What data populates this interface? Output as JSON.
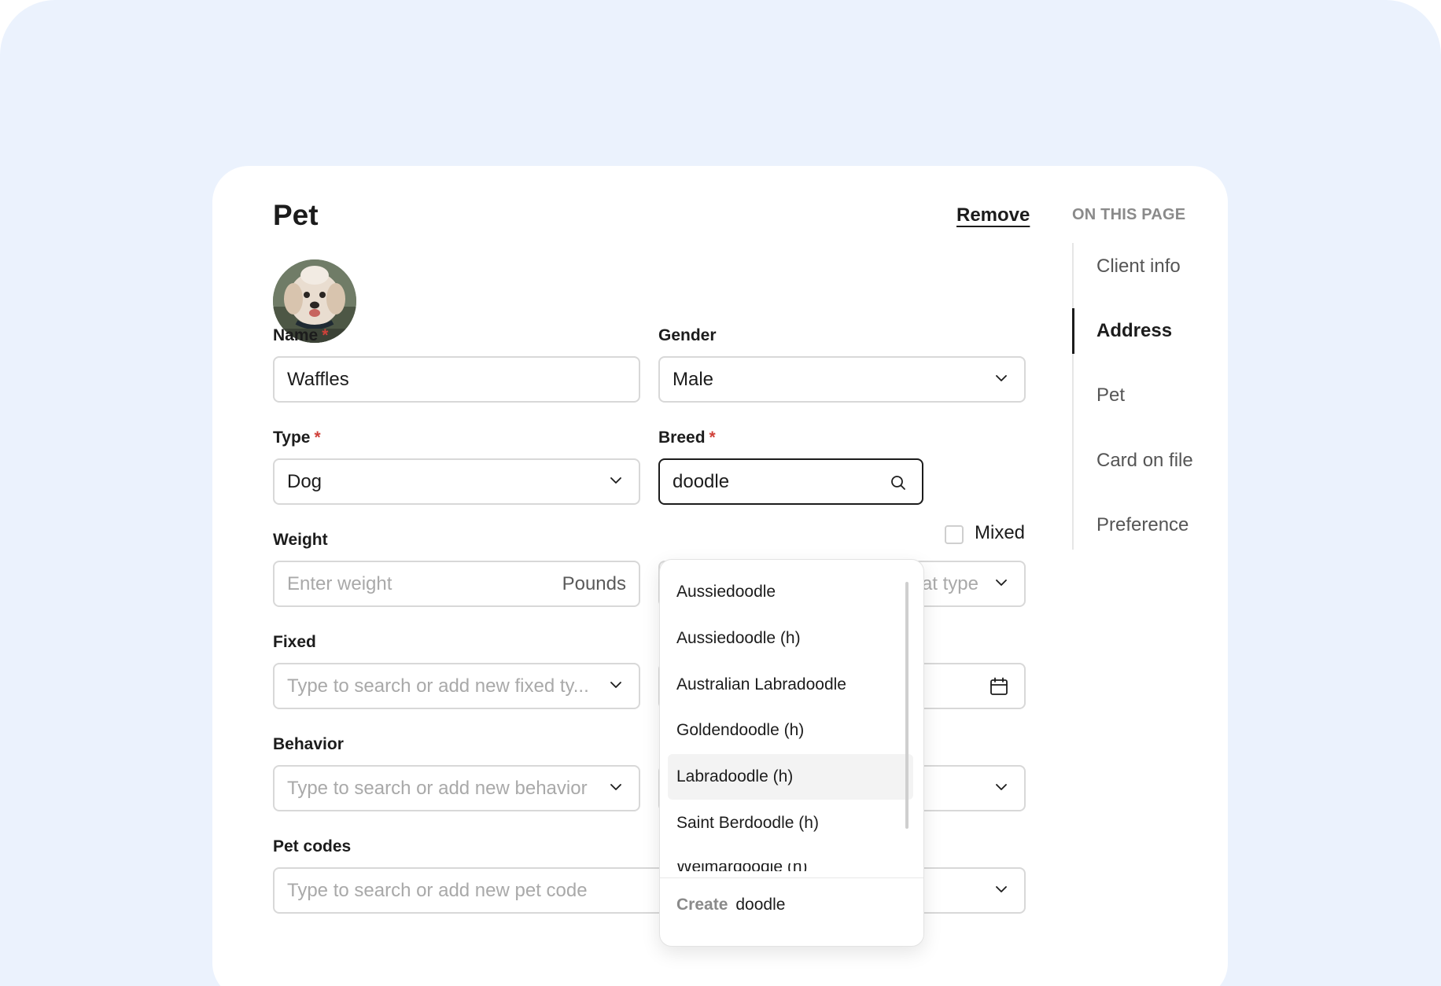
{
  "page": {
    "title": "Pet",
    "remove_label": "Remove"
  },
  "avatar": {
    "alt": "Pet photo"
  },
  "form": {
    "name": {
      "label": "Name",
      "required": "*",
      "value": "Waffles"
    },
    "gender": {
      "label": "Gender",
      "value": "Male"
    },
    "type": {
      "label": "Type",
      "required": "*",
      "value": "Dog"
    },
    "breed": {
      "label": "Breed",
      "required": "*",
      "value": "doodle",
      "mixed_label": "Mixed"
    },
    "weight": {
      "label": "Weight",
      "placeholder": "Enter weight",
      "unit": "Pounds",
      "coat_placeholder_partial": "at type"
    },
    "fixed": {
      "label": "Fixed",
      "placeholder": "Type to search or add new fixed ty..."
    },
    "behavior": {
      "label": "Behavior",
      "placeholder": "Type to search or add new behavior"
    },
    "pet_codes": {
      "label": "Pet codes",
      "placeholder": "Type to search or add new pet code"
    }
  },
  "breed_dropdown": {
    "options": [
      "Aussiedoodle",
      "Aussiedoodle (h)",
      "Australian Labradoodle",
      "Goldendoodle (h)",
      "Labradoodle (h)",
      "Saint Berdoodle (h)"
    ],
    "highlighted": "Labradoodle (h)",
    "partial_option": "Weimardoodle (h)",
    "create_label": "Create",
    "create_value": "doodle"
  },
  "toc": {
    "title": "ON THIS PAGE",
    "items": [
      "Client info",
      "Address",
      "Pet",
      "Card on file",
      "Preference"
    ],
    "active": "Address"
  },
  "icons": {
    "chevron": "chevron-down-icon",
    "search": "search-icon",
    "calendar": "calendar-icon"
  },
  "colors": {
    "background": "#ebf2fd",
    "required": "#d0413a",
    "text": "#1c1c1c"
  }
}
